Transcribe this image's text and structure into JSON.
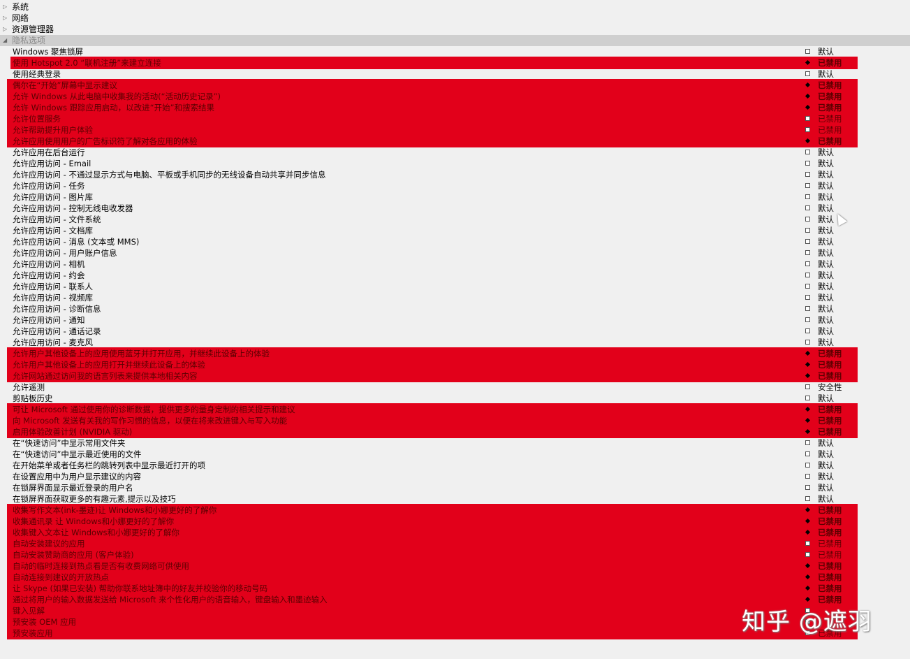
{
  "colors": {
    "highlight": "#e2001a",
    "background": "#f0f0f0"
  },
  "categories": [
    {
      "label": "系统",
      "expanded": false
    },
    {
      "label": "网络",
      "expanded": false
    },
    {
      "label": "资源管理器",
      "expanded": false
    },
    {
      "label": "隐私选项",
      "expanded": true
    }
  ],
  "items": [
    {
      "name": "Windows 聚焦锁屏",
      "value": "默认",
      "state": "unchecked"
    },
    {
      "name": "使用 Hotspot 2.0 “联机注册”来建立连接",
      "value": "已禁用",
      "state": "checked"
    },
    {
      "name": "使用经典登录",
      "value": "默认",
      "state": "unchecked"
    },
    {
      "name": "偶尔在“开始”屏幕中显示建议",
      "value": "已禁用",
      "state": "checked"
    },
    {
      "name": "允许 Windows 从此电脑中收集我的活动(“活动历史记录”)",
      "value": "已禁用",
      "state": "checked"
    },
    {
      "name": "允许 Windows 跟踪应用启动，以改进“开始”和搜索结果",
      "value": "已禁用",
      "state": "checked"
    },
    {
      "name": "允许位置服务",
      "value": "已禁用",
      "state": "unchecked"
    },
    {
      "name": "允许帮助提升用户体验",
      "value": "已禁用",
      "state": "unchecked"
    },
    {
      "name": "允许应用使用用户的广告标识符了解对各应用的体验",
      "value": "已禁用",
      "state": "checked"
    },
    {
      "name": "允许应用在后台运行",
      "value": "默认",
      "state": "unchecked"
    },
    {
      "name": "允许应用访问 - Email",
      "value": "默认",
      "state": "unchecked"
    },
    {
      "name": "允许应用访问 - 不通过显示方式与电脑、平板或手机同步的无线设备自动共享并同步信息",
      "value": "默认",
      "state": "unchecked"
    },
    {
      "name": "允许应用访问 - 任务",
      "value": "默认",
      "state": "unchecked"
    },
    {
      "name": "允许应用访问 - 图片库",
      "value": "默认",
      "state": "unchecked"
    },
    {
      "name": "允许应用访问 - 控制无线电收发器",
      "value": "默认",
      "state": "unchecked"
    },
    {
      "name": "允许应用访问 - 文件系统",
      "value": "默认",
      "state": "unchecked"
    },
    {
      "name": "允许应用访问 - 文档库",
      "value": "默认",
      "state": "unchecked"
    },
    {
      "name": "允许应用访问 - 消息 (文本或 MMS)",
      "value": "默认",
      "state": "unchecked"
    },
    {
      "name": "允许应用访问 - 用户账户信息",
      "value": "默认",
      "state": "unchecked"
    },
    {
      "name": "允许应用访问 - 相机",
      "value": "默认",
      "state": "unchecked"
    },
    {
      "name": "允许应用访问 - 约会",
      "value": "默认",
      "state": "unchecked"
    },
    {
      "name": "允许应用访问 - 联系人",
      "value": "默认",
      "state": "unchecked"
    },
    {
      "name": "允许应用访问 - 视频库",
      "value": "默认",
      "state": "unchecked"
    },
    {
      "name": "允许应用访问 - 诊断信息",
      "value": "默认",
      "state": "unchecked"
    },
    {
      "name": "允许应用访问 - 通知",
      "value": "默认",
      "state": "unchecked"
    },
    {
      "name": "允许应用访问 - 通话记录",
      "value": "默认",
      "state": "unchecked"
    },
    {
      "name": "允许应用访问 - 麦克风",
      "value": "默认",
      "state": "unchecked"
    },
    {
      "name": "允许用户其他设备上的应用使用蓝牙并打开应用，并继续此设备上的体验",
      "value": "已禁用",
      "state": "checked"
    },
    {
      "name": "允许用户其他设备上的应用打开并继续此设备上的体验",
      "value": "已禁用",
      "state": "checked"
    },
    {
      "name": "允许网站通过访问我的语言列表来提供本地相关内容",
      "value": "已禁用",
      "state": "checked"
    },
    {
      "name": "允许遥测",
      "value": "安全性",
      "state": "unchecked"
    },
    {
      "name": "剪贴板历史",
      "value": "默认",
      "state": "unchecked"
    },
    {
      "name": "可让 Microsoft 通过使用你的诊断数据，提供更多的量身定制的相关提示和建议",
      "value": "已禁用",
      "state": "checked"
    },
    {
      "name": "向 Microsoft 发送有关我的写作习惯的信息，以便在将来改进键入与写入功能",
      "value": "已禁用",
      "state": "checked"
    },
    {
      "name": "启用体验改善计划 (NVIDIA 驱动)",
      "value": "已禁用",
      "state": "checked"
    },
    {
      "name": "在“快速访问”中显示常用文件夹",
      "value": "默认",
      "state": "unchecked"
    },
    {
      "name": "在“快速访问”中显示最近使用的文件",
      "value": "默认",
      "state": "unchecked"
    },
    {
      "name": "在开始菜单或者任务栏的跳转列表中显示最近打开的项",
      "value": "默认",
      "state": "unchecked"
    },
    {
      "name": "在设置应用中为用户显示建议的内容",
      "value": "默认",
      "state": "unchecked"
    },
    {
      "name": "在锁屏界面显示最近登录的用户名",
      "value": "默认",
      "state": "unchecked"
    },
    {
      "name": "在锁屏界面获取更多的有趣元素,提示以及技巧",
      "value": "默认",
      "state": "unchecked"
    },
    {
      "name": "收集写作文本(ink-墨迹)让 Windows和小娜更好的了解你",
      "value": "已禁用",
      "state": "checked"
    },
    {
      "name": "收集通讯录 让 Windows和小娜更好的了解你",
      "value": "已禁用",
      "state": "checked"
    },
    {
      "name": "收集键入文本让 Windows和小娜更好的了解你",
      "value": "已禁用",
      "state": "checked"
    },
    {
      "name": "自动安装建议的应用",
      "value": "已禁用",
      "state": "unchecked"
    },
    {
      "name": "自动安装赞助商的应用 (客户体验)",
      "value": "已禁用",
      "state": "unchecked"
    },
    {
      "name": "自动的临时连接到热点看是否有收费网络可供使用",
      "value": "已禁用",
      "state": "checked"
    },
    {
      "name": "自动连接到建议的开放热点",
      "value": "已禁用",
      "state": "checked"
    },
    {
      "name": "让 Skype (如果已安装) 帮助你联系地址簿中的好友并校验你的移动号码",
      "value": "已禁用",
      "state": "checked"
    },
    {
      "name": "通过将用户的输入数据发送给 Microsoft 来个性化用户的语音输入，键盘输入和墨迹输入",
      "value": "已禁用",
      "state": "checked"
    },
    {
      "name": "键入见解",
      "value": "",
      "state": "unchecked"
    },
    {
      "name": "预安装 OEM 应用",
      "value": "",
      "state": "unchecked"
    },
    {
      "name": "预安装应用",
      "value": "已禁用",
      "state": "unchecked"
    }
  ],
  "highlight_groups": [
    {
      "from": 1,
      "to": 1
    },
    {
      "from": 3,
      "to": 8
    },
    {
      "from": 27,
      "to": 29
    },
    {
      "from": 32,
      "to": 34
    },
    {
      "from": 41,
      "to": 52
    }
  ],
  "watermark": "知乎 @遮羽"
}
